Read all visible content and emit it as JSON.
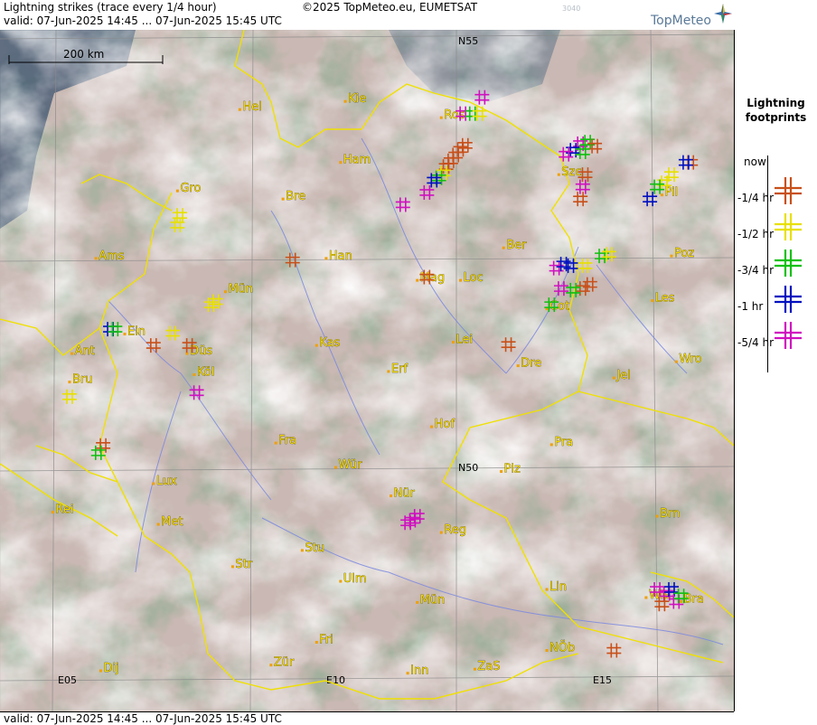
{
  "header": {
    "title": "Lightning strikes (trace every 1/4 hour)",
    "valid_range": "valid:  07-Jun-2025 14:45 ... 07-Jun-2025 15:45 UTC",
    "copyright": "©2025 TopMeteo.eu, EUMETSAT",
    "product_code": "3040",
    "brand": "TopMeteo"
  },
  "footer": {
    "valid_range": "valid:  07-Jun-2025 14:45 ... 07-Jun-2025 15:45 UTC"
  },
  "scale_bar": {
    "label": "200 km"
  },
  "grid_labels": {
    "n55": "N55",
    "n50": "N50",
    "e05": "E05",
    "e10": "E10",
    "e15": "E15"
  },
  "legend": {
    "title_line1": "Lightning",
    "title_line2": "footprints",
    "entries": [
      {
        "label": "now",
        "color": "#c8501a"
      },
      {
        "label": "-1/4 hr",
        "color": "#e8e000"
      },
      {
        "label": "-1/2 hr",
        "color": "#10c010"
      },
      {
        "label": "-3/4 hr",
        "color": "#0010c0"
      },
      {
        "label": "-1 hr",
        "color": "#d010c0"
      },
      {
        "label": "-5/4 hr",
        "color": ""
      }
    ]
  },
  "cities": [
    {
      "name": "Hel",
      "lon": 7.9,
      "lat": 54.2
    },
    {
      "name": "Kie",
      "lon": 10.1,
      "lat": 54.3
    },
    {
      "name": "Ros",
      "lon": 12.1,
      "lat": 54.1
    },
    {
      "name": "Ham",
      "lon": 10.0,
      "lat": 53.55
    },
    {
      "name": "Szc",
      "lon": 14.55,
      "lat": 53.4
    },
    {
      "name": "Gro",
      "lon": 6.6,
      "lat": 53.2
    },
    {
      "name": "Bre",
      "lon": 8.8,
      "lat": 53.1
    },
    {
      "name": "Pil",
      "lon": 16.7,
      "lat": 53.15
    },
    {
      "name": "Ber",
      "lon": 13.4,
      "lat": 52.5
    },
    {
      "name": "Ams",
      "lon": 4.9,
      "lat": 52.37
    },
    {
      "name": "Han",
      "lon": 9.7,
      "lat": 52.37
    },
    {
      "name": "Poz",
      "lon": 16.9,
      "lat": 52.4
    },
    {
      "name": "Mag",
      "lon": 11.6,
      "lat": 52.1
    },
    {
      "name": "Loc",
      "lon": 12.5,
      "lat": 52.1
    },
    {
      "name": "Mün",
      "lon": 7.6,
      "lat": 51.96
    },
    {
      "name": "Cot",
      "lon": 14.3,
      "lat": 51.75
    },
    {
      "name": "Les",
      "lon": 16.5,
      "lat": 51.85
    },
    {
      "name": "Ein",
      "lon": 5.5,
      "lat": 51.44
    },
    {
      "name": "Lei",
      "lon": 12.35,
      "lat": 51.34
    },
    {
      "name": "Kas",
      "lon": 9.5,
      "lat": 51.3
    },
    {
      "name": "Ant",
      "lon": 4.4,
      "lat": 51.2
    },
    {
      "name": "Düs",
      "lon": 6.8,
      "lat": 51.2
    },
    {
      "name": "Dre",
      "lon": 13.7,
      "lat": 51.05
    },
    {
      "name": "Wro",
      "lon": 17.0,
      "lat": 51.1
    },
    {
      "name": "Bru",
      "lon": 4.35,
      "lat": 50.85
    },
    {
      "name": "Erf",
      "lon": 11.0,
      "lat": 50.98
    },
    {
      "name": "Köl",
      "lon": 6.95,
      "lat": 50.94
    },
    {
      "name": "Jel",
      "lon": 15.7,
      "lat": 50.9
    },
    {
      "name": "Hof",
      "lon": 11.9,
      "lat": 50.3
    },
    {
      "name": "Fra",
      "lon": 8.65,
      "lat": 50.1
    },
    {
      "name": "Pra",
      "lon": 14.4,
      "lat": 50.08
    },
    {
      "name": "Wür",
      "lon": 9.9,
      "lat": 49.8
    },
    {
      "name": "Plz",
      "lon": 13.35,
      "lat": 49.75
    },
    {
      "name": "Lux",
      "lon": 6.1,
      "lat": 49.6
    },
    {
      "name": "Nür",
      "lon": 11.05,
      "lat": 49.45
    },
    {
      "name": "Rei",
      "lon": 4.0,
      "lat": 49.25
    },
    {
      "name": "Met",
      "lon": 6.2,
      "lat": 49.1
    },
    {
      "name": "Reg",
      "lon": 12.1,
      "lat": 49.0
    },
    {
      "name": "Brn",
      "lon": 16.6,
      "lat": 49.2
    },
    {
      "name": "Stu",
      "lon": 9.2,
      "lat": 48.78
    },
    {
      "name": "Str",
      "lon": 7.75,
      "lat": 48.58
    },
    {
      "name": "Ulm",
      "lon": 10.0,
      "lat": 48.4
    },
    {
      "name": "Lin",
      "lon": 14.3,
      "lat": 48.3
    },
    {
      "name": "Wie",
      "lon": 16.37,
      "lat": 48.2
    },
    {
      "name": "Bra",
      "lon": 17.1,
      "lat": 48.15
    },
    {
      "name": "Mün",
      "lon": 11.6,
      "lat": 48.14
    },
    {
      "name": "Fri",
      "lon": 9.5,
      "lat": 47.65
    },
    {
      "name": "Dij",
      "lon": 5.0,
      "lat": 47.3
    },
    {
      "name": "Zür",
      "lon": 8.55,
      "lat": 47.37
    },
    {
      "name": "NÖb",
      "lon": 14.3,
      "lat": 47.55
    },
    {
      "name": "Inn",
      "lon": 11.4,
      "lat": 47.27
    },
    {
      "name": "ZaS",
      "lon": 12.8,
      "lat": 47.32
    }
  ],
  "lightning": [
    {
      "lon": 12.2,
      "lat": 53.5,
      "age": 0
    },
    {
      "lon": 12.3,
      "lat": 53.57,
      "age": 0
    },
    {
      "lon": 12.4,
      "lat": 53.64,
      "age": 0
    },
    {
      "lon": 12.5,
      "lat": 53.71,
      "age": 0
    },
    {
      "lon": 12.6,
      "lat": 53.76,
      "age": 0
    },
    {
      "lon": 12.15,
      "lat": 53.42,
      "age": 1
    },
    {
      "lon": 12.05,
      "lat": 53.36,
      "age": 2
    },
    {
      "lon": 11.95,
      "lat": 53.33,
      "age": 3
    },
    {
      "lon": 11.8,
      "lat": 53.18,
      "age": 4
    },
    {
      "lon": 12.55,
      "lat": 54.15,
      "age": 4
    },
    {
      "lon": 12.75,
      "lat": 54.15,
      "age": 2
    },
    {
      "lon": 12.9,
      "lat": 54.15,
      "age": 1
    },
    {
      "lon": 12.95,
      "lat": 54.35,
      "age": 4
    },
    {
      "lon": 15.0,
      "lat": 53.78,
      "age": 4
    },
    {
      "lon": 15.15,
      "lat": 53.8,
      "age": 2
    },
    {
      "lon": 15.3,
      "lat": 53.75,
      "age": 0
    },
    {
      "lon": 14.85,
      "lat": 53.7,
      "age": 3
    },
    {
      "lon": 14.7,
      "lat": 53.65,
      "age": 4
    },
    {
      "lon": 15.05,
      "lat": 53.68,
      "age": 2
    },
    {
      "lon": 15.1,
      "lat": 53.4,
      "age": 0
    },
    {
      "lon": 15.05,
      "lat": 53.25,
      "age": 4
    },
    {
      "lon": 15.0,
      "lat": 53.1,
      "age": 0
    },
    {
      "lon": 17.3,
      "lat": 53.55,
      "age": 0
    },
    {
      "lon": 17.2,
      "lat": 53.55,
      "age": 3
    },
    {
      "lon": 16.9,
      "lat": 53.4,
      "age": 1
    },
    {
      "lon": 16.75,
      "lat": 53.3,
      "age": 1
    },
    {
      "lon": 16.6,
      "lat": 53.25,
      "age": 2
    },
    {
      "lon": 16.45,
      "lat": 53.1,
      "age": 3
    },
    {
      "lon": 14.5,
      "lat": 52.25,
      "age": 4
    },
    {
      "lon": 14.65,
      "lat": 52.3,
      "age": 3
    },
    {
      "lon": 14.8,
      "lat": 52.28,
      "age": 3
    },
    {
      "lon": 15.1,
      "lat": 52.28,
      "age": 1
    },
    {
      "lon": 15.45,
      "lat": 52.4,
      "age": 2
    },
    {
      "lon": 15.6,
      "lat": 52.42,
      "age": 1
    },
    {
      "lon": 15.2,
      "lat": 52.05,
      "age": 0
    },
    {
      "lon": 15.05,
      "lat": 52.0,
      "age": 0
    },
    {
      "lon": 14.85,
      "lat": 51.98,
      "age": 2
    },
    {
      "lon": 14.6,
      "lat": 52.0,
      "age": 4
    },
    {
      "lon": 14.4,
      "lat": 51.8,
      "age": 2
    },
    {
      "lon": 9.0,
      "lat": 52.35,
      "age": 0
    },
    {
      "lon": 11.8,
      "lat": 52.14,
      "age": 0
    },
    {
      "lon": 13.5,
      "lat": 51.31,
      "age": 0
    },
    {
      "lon": 11.3,
      "lat": 53.03,
      "age": 4
    },
    {
      "lon": 7.3,
      "lat": 51.8,
      "age": 1
    },
    {
      "lon": 7.4,
      "lat": 51.84,
      "age": 1
    },
    {
      "lon": 6.65,
      "lat": 52.9,
      "age": 1
    },
    {
      "lon": 6.6,
      "lat": 52.78,
      "age": 1
    },
    {
      "lon": 5.2,
      "lat": 51.5,
      "age": 3
    },
    {
      "lon": 5.3,
      "lat": 51.5,
      "age": 2
    },
    {
      "lon": 6.1,
      "lat": 51.3,
      "age": 0
    },
    {
      "lon": 6.5,
      "lat": 51.45,
      "age": 1
    },
    {
      "lon": 6.85,
      "lat": 51.3,
      "age": 0
    },
    {
      "lon": 7.0,
      "lat": 50.72,
      "age": 4
    },
    {
      "lon": 4.35,
      "lat": 50.67,
      "age": 1
    },
    {
      "lon": 5.05,
      "lat": 50.07,
      "age": 0
    },
    {
      "lon": 4.95,
      "lat": 49.98,
      "age": 2
    },
    {
      "lon": 11.4,
      "lat": 49.12,
      "age": 4
    },
    {
      "lon": 11.5,
      "lat": 49.15,
      "age": 4
    },
    {
      "lon": 11.6,
      "lat": 49.2,
      "age": 4
    },
    {
      "lon": 16.6,
      "lat": 48.3,
      "age": 4
    },
    {
      "lon": 16.8,
      "lat": 48.25,
      "age": 4
    },
    {
      "lon": 16.9,
      "lat": 48.3,
      "age": 3
    },
    {
      "lon": 17.0,
      "lat": 48.15,
      "age": 4
    },
    {
      "lon": 17.1,
      "lat": 48.22,
      "age": 2
    },
    {
      "lon": 16.7,
      "lat": 48.12,
      "age": 0
    },
    {
      "lon": 15.7,
      "lat": 47.55,
      "age": 0
    }
  ]
}
